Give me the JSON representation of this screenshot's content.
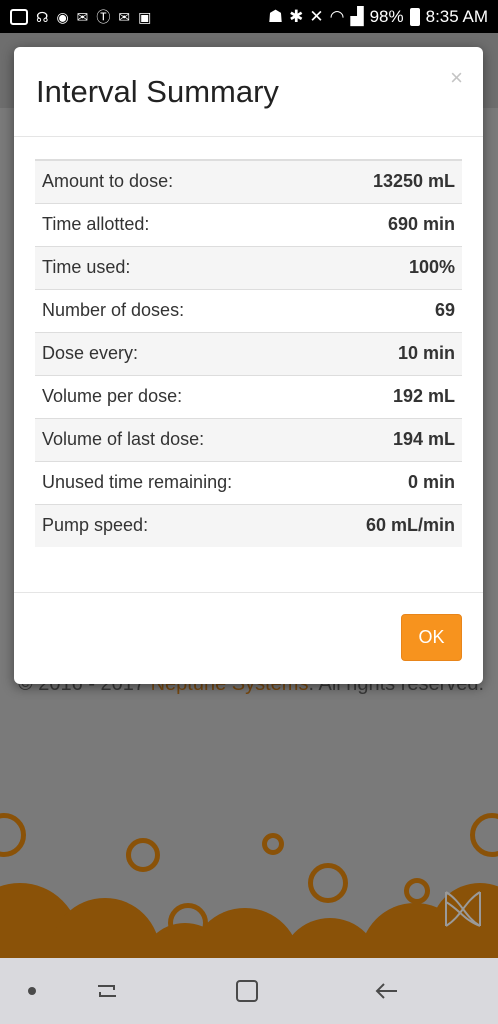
{
  "status_bar": {
    "battery": "98%",
    "time": "8:35 AM",
    "icons": [
      "messages-icon",
      "tv-icon",
      "messenger-icon",
      "email-icon",
      "tumblr-icon",
      "email-icon",
      "facebook-icon",
      "android-icon",
      "bluetooth-icon",
      "mute-icon",
      "wifi-icon",
      "signal-icon",
      "battery-icon"
    ]
  },
  "background": {
    "footer": "© 2016 - 2017 Neptune Systems. All rights reserved.",
    "footer_prefix": "© 2016 - 2017 ",
    "footer_brand": "Neptune Systems",
    "footer_suffix": ". All rights reserved."
  },
  "modal": {
    "title": "Interval Summary",
    "close_label": "×",
    "rows": [
      {
        "label": "Amount to dose:",
        "value": "13250 mL"
      },
      {
        "label": "Time allotted:",
        "value": "690 min"
      },
      {
        "label": "Time used:",
        "value": "100%"
      },
      {
        "label": "Number of doses:",
        "value": "69"
      },
      {
        "label": "Dose every:",
        "value": "10 min"
      },
      {
        "label": "Volume per dose:",
        "value": "192 mL"
      },
      {
        "label": "Volume of last dose:",
        "value": "194 mL"
      },
      {
        "label": "Unused time remaining:",
        "value": "0 min"
      },
      {
        "label": "Pump speed:",
        "value": "60 mL/min"
      }
    ],
    "ok_label": "OK"
  },
  "colors": {
    "accent": "#f7931e",
    "bubble": "#8a5208"
  }
}
